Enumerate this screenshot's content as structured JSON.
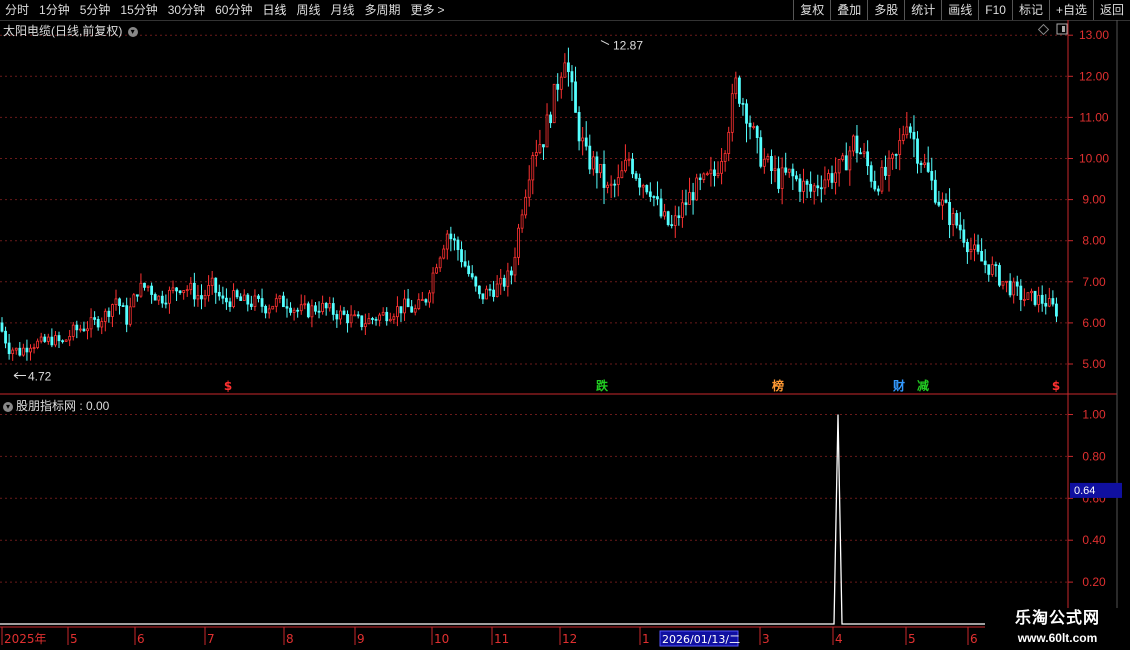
{
  "toolbar": {
    "left": [
      "分时",
      "1分钟",
      "5分钟",
      "15分钟",
      "30分钟",
      "60分钟",
      "日线",
      "周线",
      "月线",
      "多周期",
      "更多"
    ],
    "right": [
      "复权",
      "叠加",
      "多股",
      "统计",
      "画线",
      "F10",
      "标记",
      "+自选",
      "返回"
    ]
  },
  "price_chart": {
    "title": "太阳电缆(日线,前复权)",
    "y_ticks": [
      "13.00",
      "12.00",
      "11.00",
      "10.00",
      "9.00",
      "8.00",
      "7.00",
      "6.00",
      "5.00"
    ],
    "high_label": "12.87",
    "low_label": "4.72",
    "event_marks": [
      {
        "text": "$",
        "color": "#ff3030",
        "x": 228
      },
      {
        "text": "跌",
        "color": "#22cc22",
        "x": 602
      },
      {
        "text": "榜",
        "color": "#ff9933",
        "x": 778
      },
      {
        "text": "财",
        "color": "#3399ff",
        "x": 899
      },
      {
        "text": "减",
        "color": "#22cc22",
        "x": 923
      },
      {
        "text": "$",
        "color": "#ff3030",
        "x": 1056
      }
    ]
  },
  "indicator": {
    "title": "股朋指标网 : 0.00",
    "y_ticks": [
      "1.00",
      "0.80",
      "0.60",
      "0.40",
      "0.20"
    ],
    "current_value": "0.64"
  },
  "time_axis": {
    "labels": [
      "2025年",
      "5",
      "6",
      "7",
      "8",
      "9",
      "10",
      "11",
      "12",
      "1",
      "3",
      "4",
      "5",
      "6"
    ],
    "cursor_label": "2026/01/13/二"
  },
  "watermark": {
    "line1": "乐淘公式网",
    "line2": "www.60lt.com"
  },
  "chart_data": [
    {
      "type": "candlestick",
      "title": "太阳电缆(日线,前复权)",
      "ylim": [
        4.5,
        13.2
      ],
      "y_ticks": [
        5,
        6,
        7,
        8,
        9,
        10,
        11,
        12,
        13
      ],
      "close_series_approx": [
        6.0,
        5.4,
        5.3,
        5.5,
        5.5,
        5.6,
        5.5,
        5.8,
        5.9,
        6.0,
        6.2,
        6.6,
        6.1,
        6.8,
        6.9,
        6.6,
        6.7,
        6.9,
        6.8,
        6.6,
        6.9,
        6.5,
        6.6,
        6.5,
        6.5,
        6.4,
        6.5,
        6.5,
        6.3,
        6.3,
        6.4,
        6.3,
        6.2,
        6.1,
        6.0,
        6.1,
        6.2,
        6.3,
        6.4,
        6.3,
        6.6,
        7.5,
        8.2,
        7.8,
        7.2,
        6.6,
        6.8,
        6.9,
        7.2,
        8.8,
        10.2,
        10.5,
        11.5,
        12.6,
        11.0,
        10.0,
        9.8,
        9.2,
        9.4,
        10.0,
        9.5,
        9.3,
        8.6,
        8.3,
        8.8,
        9.2,
        9.4,
        9.6,
        10.4,
        11.8,
        11.2,
        10.2,
        9.8,
        9.5,
        9.6,
        9.4,
        9.2,
        9.5,
        9.6,
        9.8,
        10.4,
        10.0,
        9.4,
        9.6,
        10.0,
        11.0,
        10.2,
        9.6,
        9.0,
        8.6,
        8.3,
        7.8,
        7.5,
        7.3,
        7.0,
        6.8,
        6.6,
        6.6,
        6.5,
        6.3
      ],
      "high": 12.87,
      "low": 4.72
    },
    {
      "type": "line",
      "title": "股朋指标网",
      "ylim": [
        0,
        1.1
      ],
      "y_ticks": [
        0.2,
        0.4,
        0.6,
        0.8,
        1.0
      ],
      "spike": {
        "x_label": "4",
        "value": 1.0
      },
      "current_value": 0.64
    }
  ]
}
